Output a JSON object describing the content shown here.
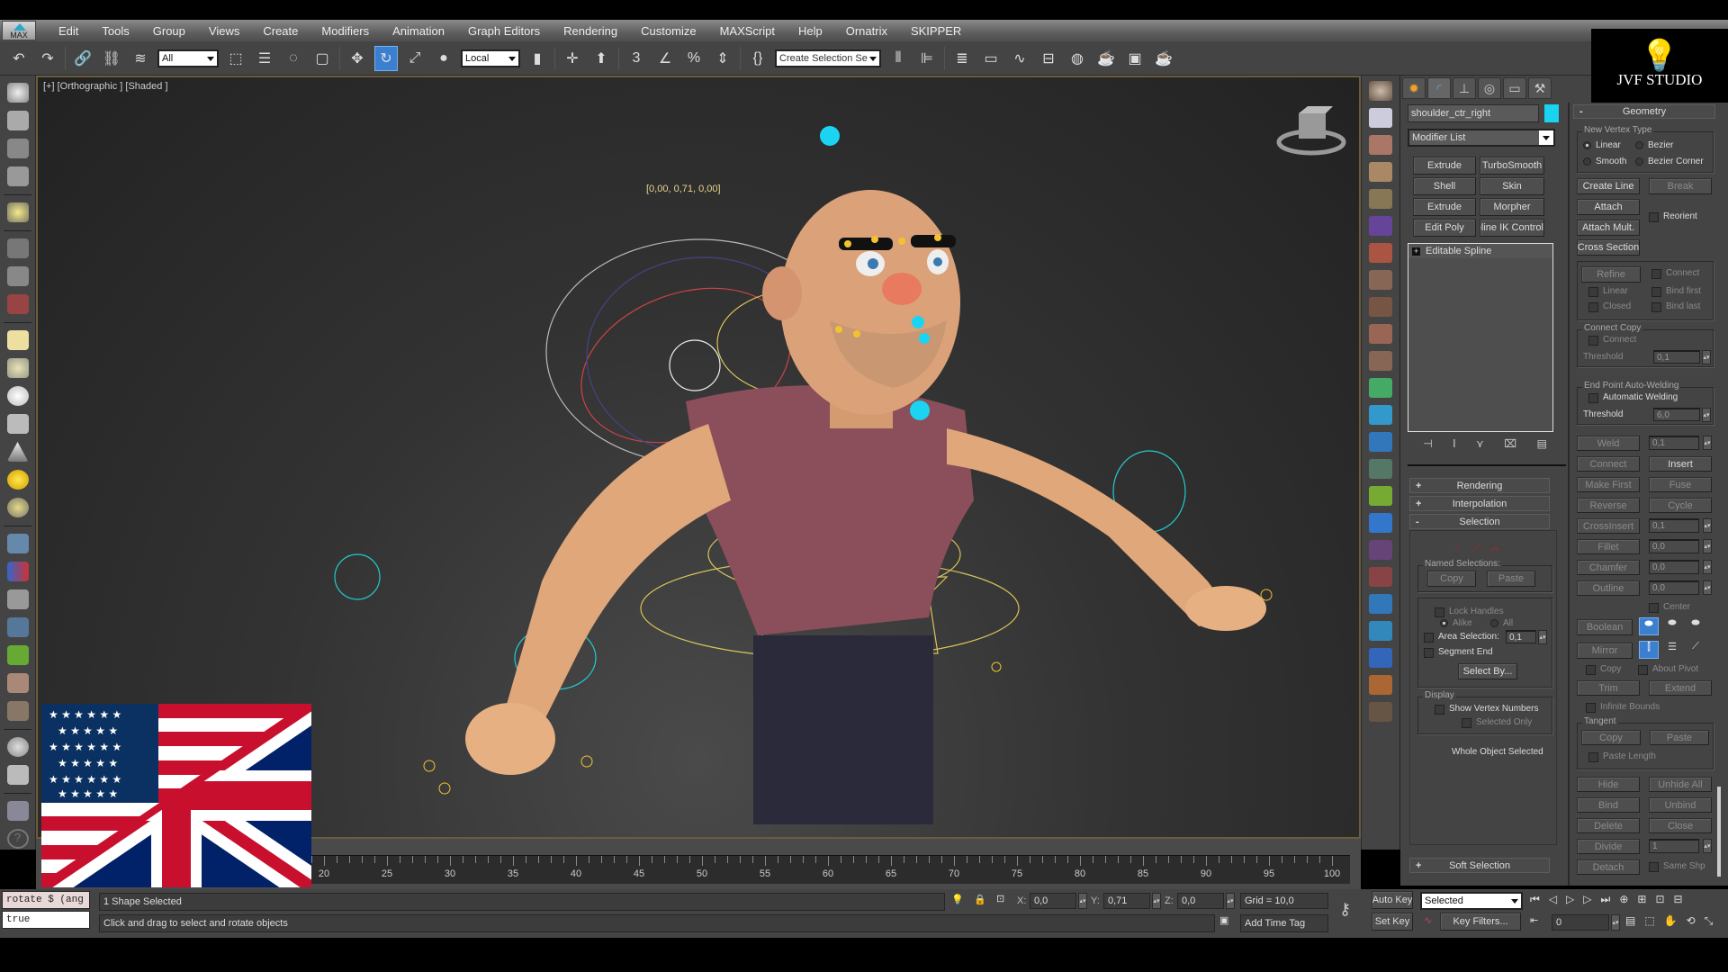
{
  "app": {
    "logo_label": "MAX",
    "branding": "JVF STUDIO"
  },
  "menu": [
    "Edit",
    "Tools",
    "Group",
    "Views",
    "Create",
    "Modifiers",
    "Animation",
    "Graph Editors",
    "Rendering",
    "Customize",
    "MAXScript",
    "Help",
    "Ornatrix",
    "SKIPPER"
  ],
  "toolbar": {
    "selection_filter": "All",
    "reference_coord": "Local",
    "named_selection_placeholder": "Create Selection Se",
    "active_tool": "select-and-rotate"
  },
  "viewport": {
    "label": "[+] [Orthographic ] [Shaded ]",
    "transform_readout": "[0,00, 0,71, 0,00]"
  },
  "command_panel": {
    "tabs": [
      "create",
      "modify",
      "hierarchy",
      "motion",
      "display",
      "utilities"
    ],
    "active_tab": "modify",
    "object_name": "shoulder_ctr_right",
    "object_color": "#19d3f0",
    "modifier_list": "Modifier List",
    "modifier_buttons": [
      "Extrude",
      "TurboSmooth",
      "Shell",
      "Skin",
      "Extrude",
      "Morpher",
      "Edit Poly",
      "Spline IK Control"
    ],
    "stack": [
      {
        "label": "Editable Spline",
        "expand": "+"
      }
    ],
    "rollouts": [
      {
        "sign": "+",
        "label": "Rendering"
      },
      {
        "sign": "+",
        "label": "Interpolation"
      },
      {
        "sign": "-",
        "label": "Selection"
      },
      {
        "sign": "+",
        "label": "Soft Selection"
      }
    ],
    "selection": {
      "named_selections_label": "Named Selections:",
      "copy": "Copy",
      "paste": "Paste",
      "lock_handles": "Lock Handles",
      "alike": "Alike",
      "all": "All",
      "area_selection": "Area Selection:",
      "area_value": "0,1",
      "segment_end": "Segment End",
      "select_by": "Select By...",
      "display_label": "Display",
      "show_vertex_numbers": "Show Vertex Numbers",
      "selected_only": "Selected Only",
      "status": "Whole Object Selected"
    },
    "geometry": {
      "title": "Geometry",
      "new_vertex_type_label": "New Vertex Type",
      "vertex_types": [
        {
          "label": "Linear",
          "selected": true
        },
        {
          "label": "Bezier",
          "selected": false
        },
        {
          "label": "Smooth",
          "selected": false
        },
        {
          "label": "Bezier Corner",
          "selected": false
        }
      ],
      "create_line": "Create Line",
      "break": "Break",
      "attach": "Attach",
      "reorient": "Reorient",
      "attach_mult": "Attach Mult.",
      "cross_section": "Cross Section",
      "refine": "Refine",
      "connect": "Connect",
      "linear": "Linear",
      "bind_first": "Bind first",
      "closed": "Closed",
      "bind_last": "Bind last",
      "connect_copy_label": "Connect Copy",
      "connect_copy_connect": "Connect",
      "threshold_label": "Threshold",
      "connect_copy_threshold": "0,1",
      "end_point_label": "End Point Auto-Welding",
      "automatic_welding": "Automatic Welding",
      "weld_threshold": "6,0",
      "weld": "Weld",
      "weld_value": "0,1",
      "connect_btn": "Connect",
      "insert": "Insert",
      "make_first": "Make First",
      "fuse": "Fuse",
      "reverse": "Reverse",
      "cycle": "Cycle",
      "crossinsert": "CrossInsert",
      "crossinsert_value": "0,1",
      "fillet": "Fillet",
      "fillet_value": "0,0",
      "chamfer": "Chamfer",
      "chamfer_value": "0,0",
      "outline": "Outline",
      "outline_value": "0,0",
      "center": "Center",
      "boolean": "Boolean",
      "mirror": "Mirror",
      "copy": "Copy",
      "about_pivot": "About Pivot",
      "trim": "Trim",
      "extend": "Extend",
      "infinite_bounds": "Infinite Bounds",
      "tangent_label": "Tangent",
      "tangent_copy": "Copy",
      "tangent_paste": "Paste",
      "paste_length": "Paste Length",
      "hide": "Hide",
      "unhide_all": "Unhide All",
      "bind": "Bind",
      "unbind": "Unbind",
      "delete": "Delete",
      "close": "Close",
      "divide": "Divide",
      "divide_value": "1",
      "detach": "Detach",
      "same_shp": "Same Shp"
    }
  },
  "timeline": {
    "ticks": [
      20,
      25,
      30,
      35,
      40,
      45,
      50,
      55,
      60,
      65,
      70,
      75,
      80,
      85,
      90,
      95,
      100
    ],
    "range_end": 100
  },
  "status": {
    "maxscript_input": "rotate $ (ang",
    "maxscript_output": "true",
    "selection_status": "1 Shape Selected",
    "prompt": "Click and drag to select and rotate objects",
    "x_label": "X:",
    "x": "0,0",
    "y_label": "Y:",
    "y": "0,71",
    "z_label": "Z:",
    "z": "0,0",
    "grid": "Grid = 10,0",
    "add_time_tag": "Add Time Tag",
    "auto_key": "Auto Key",
    "set_key": "Set Key",
    "key_mode": "Selected",
    "key_filters": "Key Filters...",
    "current_frame": "0"
  },
  "overlay": {
    "flag": "US-UK language flag"
  }
}
